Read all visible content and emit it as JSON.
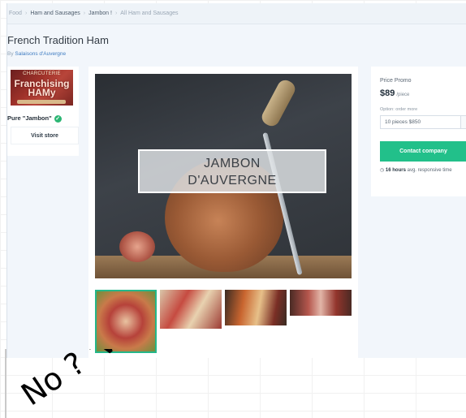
{
  "breadcrumb": [
    "Food",
    "Ham and Sausages",
    "Jambon !",
    "All Ham and Sausages"
  ],
  "product": {
    "title": "French Tradition Ham",
    "by_prefix": "By",
    "seller": "Salaisons d'Auvergne"
  },
  "store": {
    "logo_top": "CHARCUTERIE",
    "logo_main": "Franchising HAMy",
    "name": "Pure \"Jambon\"",
    "verified_glyph": "✓",
    "visit_label": "Visit store"
  },
  "gallery": {
    "hero_label_line1": "JAMBON",
    "hero_label_line2": "D'AUVERGNE",
    "thumbnails": [
      "charcuterie-platter",
      "ham-board",
      "dark-board-platter",
      "sausages"
    ]
  },
  "pricing": {
    "label": "Price Promo",
    "amount": "$89",
    "unit": "/piece",
    "option_label": "Option: order more",
    "option_value": "10 pieces $850"
  },
  "actions": {
    "contact_label": "Contact company"
  },
  "response": {
    "time": "16 hours",
    "suffix": "avg. responsive time"
  },
  "handwriting": {
    "text": "No ? 'V '5"
  },
  "colors": {
    "accent_green": "#22c08a",
    "seller_blue": "#3f7cc2",
    "thumb_border": "#25b789"
  }
}
